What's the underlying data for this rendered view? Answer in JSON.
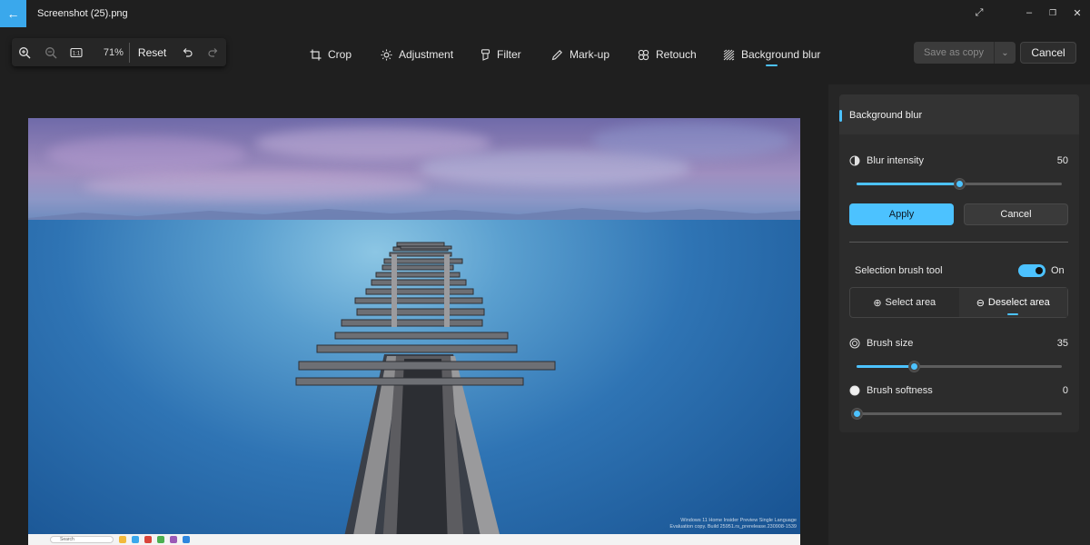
{
  "window": {
    "title": "Screenshot (25).png",
    "back_icon": "arrow-left-icon"
  },
  "toolbar": {
    "zoom_value": "71%",
    "reset_label": "Reset"
  },
  "tabs": [
    {
      "label": "Crop",
      "icon": "crop-icon"
    },
    {
      "label": "Adjustment",
      "icon": "sun-icon"
    },
    {
      "label": "Filter",
      "icon": "filter-icon"
    },
    {
      "label": "Mark-up",
      "icon": "pen-icon"
    },
    {
      "label": "Retouch",
      "icon": "retouch-icon"
    },
    {
      "label": "Background blur",
      "icon": "blur-icon",
      "active": true
    }
  ],
  "actions": {
    "save_as_copy": "Save as copy",
    "cancel": "Cancel"
  },
  "panel": {
    "title": "Background blur",
    "blur_intensity_label": "Blur intensity",
    "blur_intensity_value": "50",
    "blur_intensity_fraction": 0.5,
    "apply_label": "Apply",
    "cancel_label": "Cancel",
    "selection_brush_label": "Selection brush tool",
    "selection_brush_state": "On",
    "select_area_label": "Select area",
    "deselect_area_label": "Deselect area",
    "brush_size_label": "Brush size",
    "brush_size_value": "35",
    "brush_size_fraction": 0.28,
    "brush_softness_label": "Brush softness",
    "brush_softness_value": "0",
    "brush_softness_fraction": 0.0
  },
  "image": {
    "watermark_line1": "Windows 11 Home Insider Preview Single Language",
    "watermark_line2": "Evaluation copy. Build 25951.rs_prerelease.230908-1539",
    "taskbar_search": "Search"
  },
  "colors": {
    "accent": "#4cc2ff",
    "background": "#1f1f1f",
    "panel": "#2c2c2c"
  }
}
